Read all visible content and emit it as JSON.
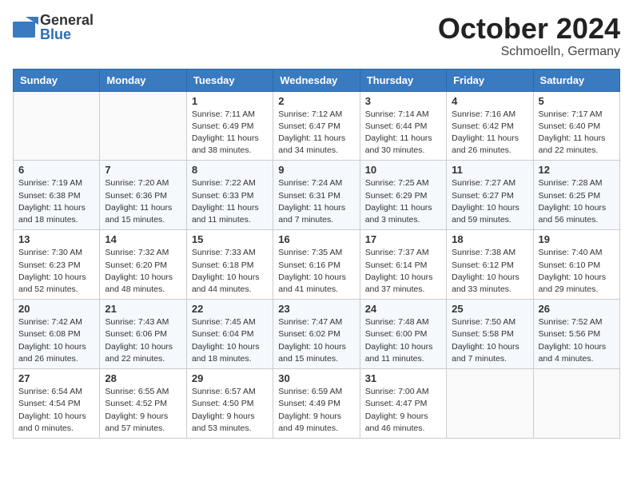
{
  "header": {
    "logo_general": "General",
    "logo_blue": "Blue",
    "month_title": "October 2024",
    "location": "Schmoelln, Germany"
  },
  "columns": [
    "Sunday",
    "Monday",
    "Tuesday",
    "Wednesday",
    "Thursday",
    "Friday",
    "Saturday"
  ],
  "weeks": [
    {
      "days": [
        {
          "num": "",
          "info": ""
        },
        {
          "num": "",
          "info": ""
        },
        {
          "num": "1",
          "info": "Sunrise: 7:11 AM\nSunset: 6:49 PM\nDaylight: 11 hours and 38 minutes."
        },
        {
          "num": "2",
          "info": "Sunrise: 7:12 AM\nSunset: 6:47 PM\nDaylight: 11 hours and 34 minutes."
        },
        {
          "num": "3",
          "info": "Sunrise: 7:14 AM\nSunset: 6:44 PM\nDaylight: 11 hours and 30 minutes."
        },
        {
          "num": "4",
          "info": "Sunrise: 7:16 AM\nSunset: 6:42 PM\nDaylight: 11 hours and 26 minutes."
        },
        {
          "num": "5",
          "info": "Sunrise: 7:17 AM\nSunset: 6:40 PM\nDaylight: 11 hours and 22 minutes."
        }
      ]
    },
    {
      "days": [
        {
          "num": "6",
          "info": "Sunrise: 7:19 AM\nSunset: 6:38 PM\nDaylight: 11 hours and 18 minutes."
        },
        {
          "num": "7",
          "info": "Sunrise: 7:20 AM\nSunset: 6:36 PM\nDaylight: 11 hours and 15 minutes."
        },
        {
          "num": "8",
          "info": "Sunrise: 7:22 AM\nSunset: 6:33 PM\nDaylight: 11 hours and 11 minutes."
        },
        {
          "num": "9",
          "info": "Sunrise: 7:24 AM\nSunset: 6:31 PM\nDaylight: 11 hours and 7 minutes."
        },
        {
          "num": "10",
          "info": "Sunrise: 7:25 AM\nSunset: 6:29 PM\nDaylight: 11 hours and 3 minutes."
        },
        {
          "num": "11",
          "info": "Sunrise: 7:27 AM\nSunset: 6:27 PM\nDaylight: 10 hours and 59 minutes."
        },
        {
          "num": "12",
          "info": "Sunrise: 7:28 AM\nSunset: 6:25 PM\nDaylight: 10 hours and 56 minutes."
        }
      ]
    },
    {
      "days": [
        {
          "num": "13",
          "info": "Sunrise: 7:30 AM\nSunset: 6:23 PM\nDaylight: 10 hours and 52 minutes."
        },
        {
          "num": "14",
          "info": "Sunrise: 7:32 AM\nSunset: 6:20 PM\nDaylight: 10 hours and 48 minutes."
        },
        {
          "num": "15",
          "info": "Sunrise: 7:33 AM\nSunset: 6:18 PM\nDaylight: 10 hours and 44 minutes."
        },
        {
          "num": "16",
          "info": "Sunrise: 7:35 AM\nSunset: 6:16 PM\nDaylight: 10 hours and 41 minutes."
        },
        {
          "num": "17",
          "info": "Sunrise: 7:37 AM\nSunset: 6:14 PM\nDaylight: 10 hours and 37 minutes."
        },
        {
          "num": "18",
          "info": "Sunrise: 7:38 AM\nSunset: 6:12 PM\nDaylight: 10 hours and 33 minutes."
        },
        {
          "num": "19",
          "info": "Sunrise: 7:40 AM\nSunset: 6:10 PM\nDaylight: 10 hours and 29 minutes."
        }
      ]
    },
    {
      "days": [
        {
          "num": "20",
          "info": "Sunrise: 7:42 AM\nSunset: 6:08 PM\nDaylight: 10 hours and 26 minutes."
        },
        {
          "num": "21",
          "info": "Sunrise: 7:43 AM\nSunset: 6:06 PM\nDaylight: 10 hours and 22 minutes."
        },
        {
          "num": "22",
          "info": "Sunrise: 7:45 AM\nSunset: 6:04 PM\nDaylight: 10 hours and 18 minutes."
        },
        {
          "num": "23",
          "info": "Sunrise: 7:47 AM\nSunset: 6:02 PM\nDaylight: 10 hours and 15 minutes."
        },
        {
          "num": "24",
          "info": "Sunrise: 7:48 AM\nSunset: 6:00 PM\nDaylight: 10 hours and 11 minutes."
        },
        {
          "num": "25",
          "info": "Sunrise: 7:50 AM\nSunset: 5:58 PM\nDaylight: 10 hours and 7 minutes."
        },
        {
          "num": "26",
          "info": "Sunrise: 7:52 AM\nSunset: 5:56 PM\nDaylight: 10 hours and 4 minutes."
        }
      ]
    },
    {
      "days": [
        {
          "num": "27",
          "info": "Sunrise: 6:54 AM\nSunset: 4:54 PM\nDaylight: 10 hours and 0 minutes."
        },
        {
          "num": "28",
          "info": "Sunrise: 6:55 AM\nSunset: 4:52 PM\nDaylight: 9 hours and 57 minutes."
        },
        {
          "num": "29",
          "info": "Sunrise: 6:57 AM\nSunset: 4:50 PM\nDaylight: 9 hours and 53 minutes."
        },
        {
          "num": "30",
          "info": "Sunrise: 6:59 AM\nSunset: 4:49 PM\nDaylight: 9 hours and 49 minutes."
        },
        {
          "num": "31",
          "info": "Sunrise: 7:00 AM\nSunset: 4:47 PM\nDaylight: 9 hours and 46 minutes."
        },
        {
          "num": "",
          "info": ""
        },
        {
          "num": "",
          "info": ""
        }
      ]
    }
  ]
}
